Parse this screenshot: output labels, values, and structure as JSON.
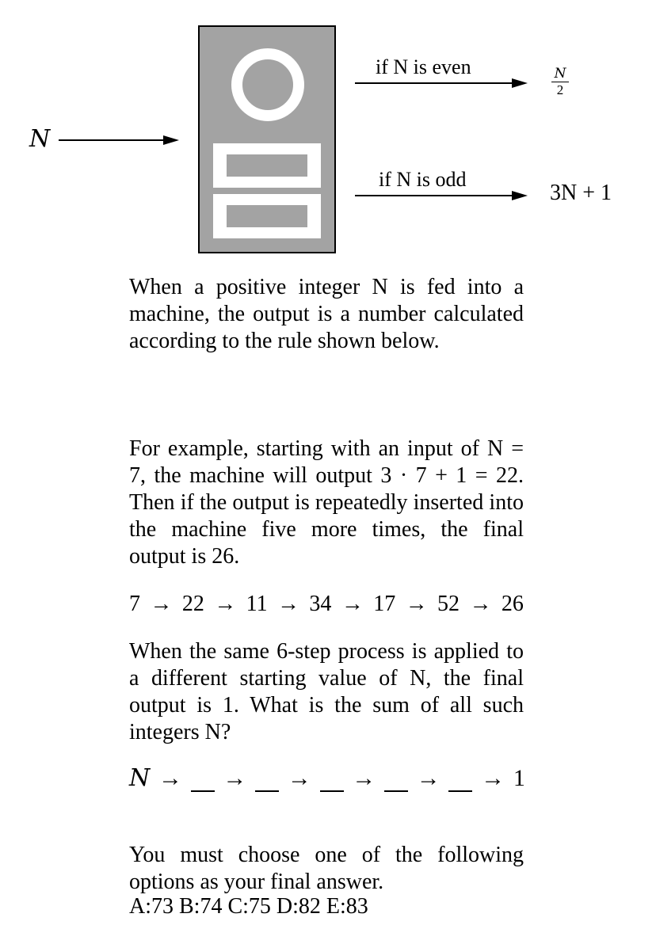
{
  "diagram": {
    "input_label": "N",
    "even_condition": "if N is even",
    "odd_condition": "if N is odd",
    "even_output_numerator": "N",
    "even_output_denominator": "2",
    "odd_output": "3N + 1"
  },
  "paragraphs": {
    "intro": "When a positive integer N is fed into a machine, the output is a number calculated according to the rule shown below.",
    "example": "For example, starting with an input of N = 7, the machine will output 3 · 7 + 1 = 22. Then if the output is repeatedly inserted into the machine five more times, the final output is 26.",
    "question": "When the same 6-step process is applied to a different starting value of N, the final output is 1. What is the sum of all such integers N?",
    "instruction": "You must choose one of the following options as your final answer."
  },
  "sequence_example": [
    "7",
    "→",
    "22",
    "→",
    "11",
    "→",
    "34",
    "→",
    "17",
    "→",
    "52",
    "→",
    "26"
  ],
  "sequence_blank": {
    "start": "N",
    "arrow": "→",
    "end": "1"
  },
  "options": "A:73 B:74 C:75 D:82 E:83"
}
